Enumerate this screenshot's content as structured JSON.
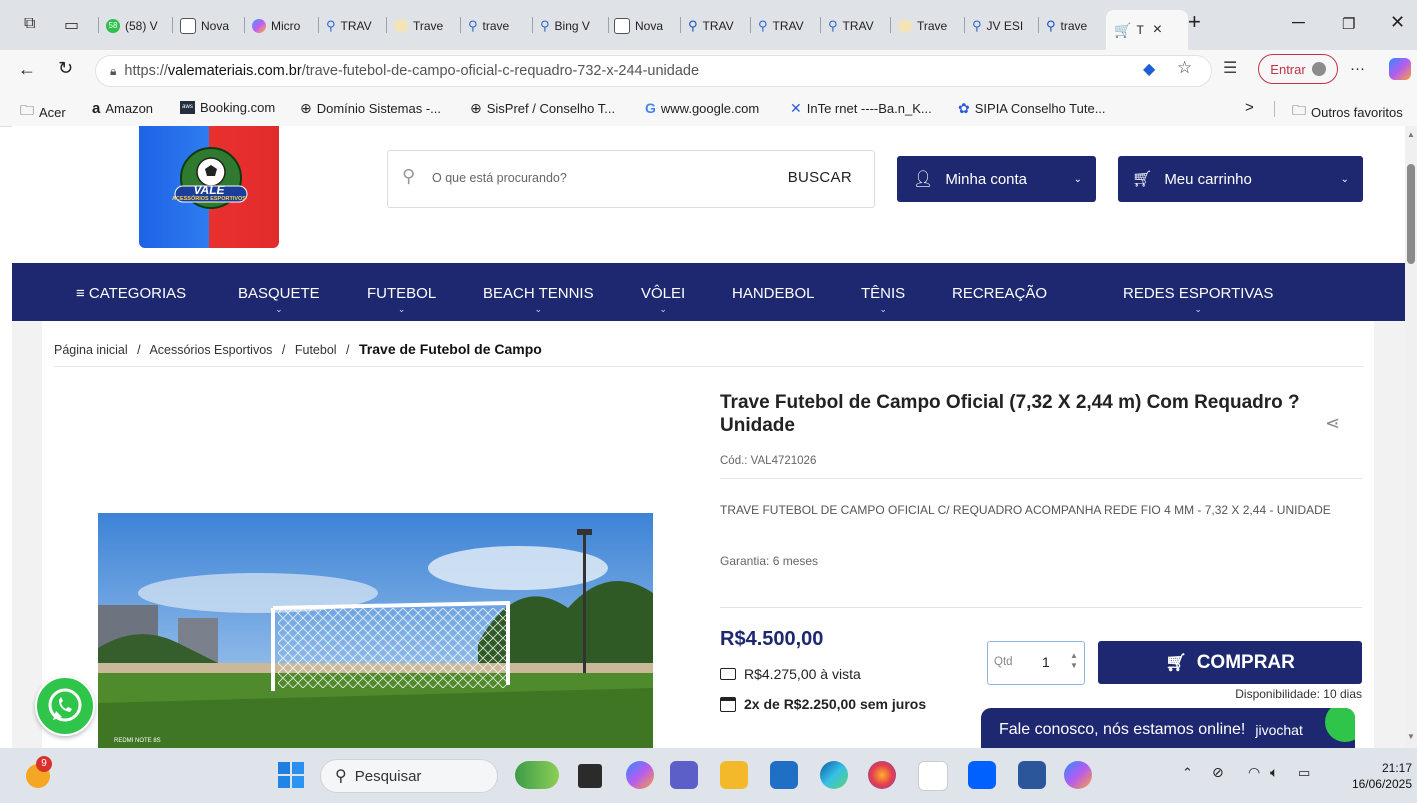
{
  "browser": {
    "tabs": [
      {
        "label": "(58) V",
        "badge": "58"
      },
      {
        "label": "Nova"
      },
      {
        "label": "Micro"
      },
      {
        "label": "TRAV"
      },
      {
        "label": "Trave"
      },
      {
        "label": "trave"
      },
      {
        "label": "Bing V"
      },
      {
        "label": "Nova"
      },
      {
        "label": "TRAV"
      },
      {
        "label": "TRAV"
      },
      {
        "label": "TRAV"
      },
      {
        "label": "Trave"
      },
      {
        "label": "JV ESI"
      },
      {
        "label": "trave"
      }
    ],
    "active_tab": {
      "label": "T",
      "close": "×"
    },
    "new_tab": "+",
    "url_prefix": "https://",
    "url_host": "valemateriais.com.br",
    "url_path": "/trave-futebol-de-campo-oficial-c-requadro-732-x-244-unidade",
    "signin_label": "Entrar",
    "more_label": "···",
    "bookmarks": [
      {
        "label": "Acer",
        "icon": "folder-icon"
      },
      {
        "label": "Amazon",
        "icon": "amazon-icon"
      },
      {
        "label": "Booking.com",
        "icon": "aws-icon"
      },
      {
        "label": "Domínio Sistemas -...",
        "icon": "globe-icon"
      },
      {
        "label": "SisPref / Conselho T...",
        "icon": "globe-icon"
      },
      {
        "label": "www.google.com",
        "icon": "google-icon"
      },
      {
        "label": "InTe rnet ----Ba.n_K...",
        "icon": "x-icon"
      },
      {
        "label": "SIPIA Conselho Tute...",
        "icon": "sipia-icon"
      }
    ],
    "bookmarks_more": ">",
    "other_favorites": "Outros favoritos"
  },
  "site": {
    "search_placeholder": "O que está procurando?",
    "search_button": "BUSCAR",
    "account_label": "Minha conta",
    "cart_label": "Meu carrinho",
    "logo": {
      "title": "VALE",
      "subtitle": "ACESSÓRIOS ESPORTIVOS"
    },
    "categories": [
      {
        "label": "≡ CATEGORIAS",
        "chevron": false
      },
      {
        "label": "BASQUETE",
        "chevron": true
      },
      {
        "label": "FUTEBOL",
        "chevron": true
      },
      {
        "label": "BEACH TENNIS",
        "chevron": true
      },
      {
        "label": "VÔLEI",
        "chevron": true
      },
      {
        "label": "HANDEBOL",
        "chevron": false
      },
      {
        "label": "TÊNIS",
        "chevron": true
      },
      {
        "label": "RECREAÇÃO",
        "chevron": false
      },
      {
        "label": "REDES ESPORTIVAS",
        "chevron": true
      }
    ],
    "breadcrumb": {
      "home": "Página inicial",
      "c1": "Acessórios Esportivos",
      "c2": "Futebol",
      "current": "Trave de Futebol de Campo",
      "sep": "/"
    }
  },
  "product": {
    "title": "Trave Futebol de Campo Oficial (7,32 X 2,44 m) Com Requadro ? Unidade",
    "sku": "Cód.: VAL4721026",
    "description": "TRAVE FUTEBOL DE CAMPO OFICIAL C/ REQUADRO ACOMPANHA REDE FIO 4 MM - 7,32 X 2,44 - UNIDADE",
    "warranty": "Garantia: 6 meses",
    "price": "R$4.500,00",
    "cash_price": "R$4.275,00 à vista",
    "installments": "2x de R$2.250,00 sem juros",
    "qty_label": "Qtd",
    "qty_value": "1",
    "buy_label": "COMPRAR",
    "availability": "Disponibilidade: 10 dias",
    "photo_watermark": "REDMI NOTE 8S"
  },
  "chat": {
    "message": "Fale conosco, nós estamos online!",
    "brand": "jivochat"
  },
  "taskbar": {
    "search_placeholder": "Pesquisar",
    "weather_badge": "9",
    "time": "21:17",
    "date": "16/06/2025"
  },
  "colors": {
    "brand_navy": "#1d2870",
    "whatsapp_green": "#2fc54a",
    "signin_red": "#c0334a"
  }
}
